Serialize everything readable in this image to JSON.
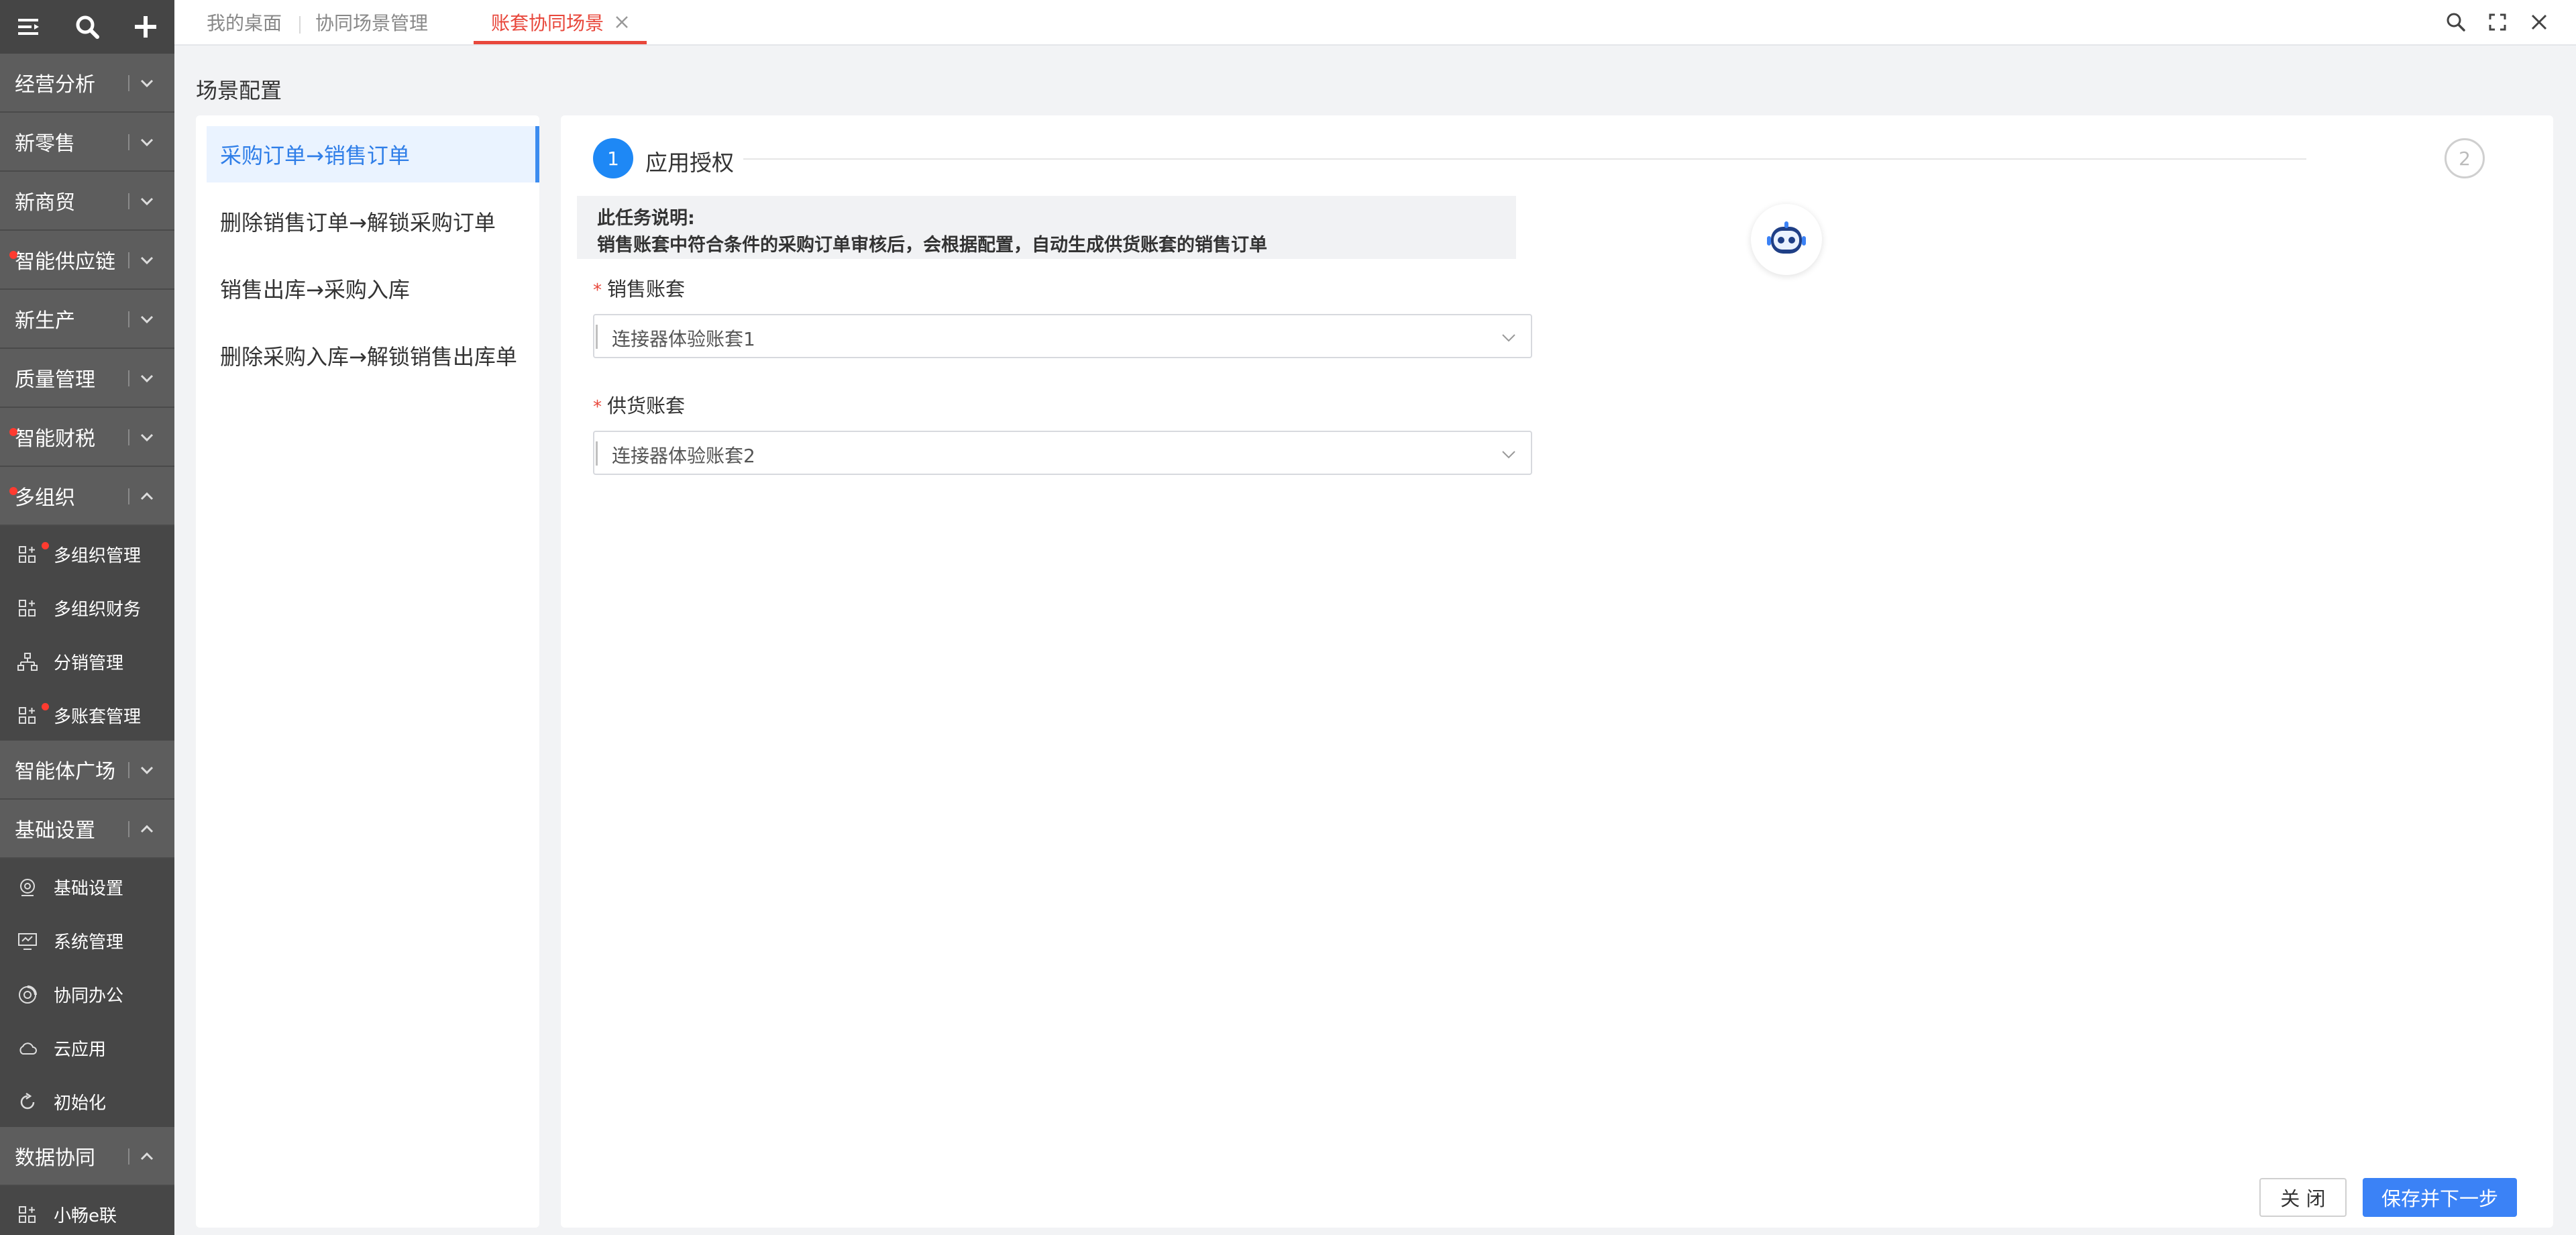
{
  "sidebar": {
    "toolbar": [
      {
        "icon": "menu-collapse-icon"
      },
      {
        "icon": "search-icon"
      },
      {
        "icon": "plus-icon"
      }
    ],
    "menu": [
      {
        "type": "cat",
        "label": "经营分析",
        "expanded": false,
        "dot": false
      },
      {
        "type": "cat",
        "label": "新零售",
        "expanded": false,
        "dot": false
      },
      {
        "type": "cat",
        "label": "新商贸",
        "expanded": false,
        "dot": false
      },
      {
        "type": "cat",
        "label": "智能供应链",
        "expanded": false,
        "dot": true
      },
      {
        "type": "cat",
        "label": "新生产",
        "expanded": false,
        "dot": false
      },
      {
        "type": "cat",
        "label": "质量管理",
        "expanded": false,
        "dot": false
      },
      {
        "type": "cat",
        "label": "智能财税",
        "expanded": false,
        "dot": true
      },
      {
        "type": "cat",
        "label": "多组织",
        "expanded": true,
        "dot": true
      },
      {
        "type": "sub",
        "label": "多组织管理",
        "icon": "grid-plus-icon",
        "dot": true
      },
      {
        "type": "sub",
        "label": "多组织财务",
        "icon": "grid-plus-icon",
        "dot": false
      },
      {
        "type": "sub",
        "label": "分销管理",
        "icon": "hierarchy-icon",
        "dot": false
      },
      {
        "type": "sub",
        "label": "多账套管理",
        "icon": "grid-plus-icon",
        "dot": true
      },
      {
        "type": "cat",
        "label": "智能体广场",
        "expanded": false,
        "dot": false
      },
      {
        "type": "cat",
        "label": "基础设置",
        "expanded": true,
        "dot": false
      },
      {
        "type": "sub",
        "label": "基础设置",
        "icon": "webcam-icon",
        "dot": false
      },
      {
        "type": "sub",
        "label": "系统管理",
        "icon": "monitor-icon",
        "dot": false
      },
      {
        "type": "sub",
        "label": "协同办公",
        "icon": "collab-icon",
        "dot": false
      },
      {
        "type": "sub",
        "label": "云应用",
        "icon": "cloud-icon",
        "dot": false
      },
      {
        "type": "sub",
        "label": "初始化",
        "icon": "refresh-icon",
        "dot": false
      },
      {
        "type": "cat",
        "label": "数据协同",
        "expanded": true,
        "dot": false
      },
      {
        "type": "sub",
        "label": "小畅e联",
        "icon": "grid-plus-icon",
        "dot": false
      }
    ]
  },
  "tabs": [
    {
      "label": "我的桌面",
      "active": false
    },
    {
      "label": "协同场景管理",
      "active": false
    },
    {
      "label": "账套协同场景",
      "active": true
    }
  ],
  "window_controls": [
    "search-icon",
    "fullscreen-icon",
    "close-icon"
  ],
  "page": {
    "title": "场景配置"
  },
  "scenes": [
    {
      "label": "采购订单→销售订单",
      "selected": true
    },
    {
      "label": "删除销售订单→解锁采购订单",
      "selected": false
    },
    {
      "label": "销售出库→采购入库",
      "selected": false
    },
    {
      "label": "删除采购入库→解锁销售出库单",
      "selected": false
    }
  ],
  "steps": [
    {
      "number": "1",
      "label": "应用授权",
      "active": true
    },
    {
      "number": "2",
      "label": "",
      "active": false
    }
  ],
  "description": {
    "title": "此任务说明:",
    "text": "销售账套中符合条件的采购订单审核后，会根据配置，自动生成供货账套的销售订单"
  },
  "form": {
    "required_mark": "*",
    "sales_account": {
      "label": "销售账套",
      "value": "连接器体验账套1"
    },
    "supply_account": {
      "label": "供货账套",
      "value": "连接器体验账套2"
    }
  },
  "buttons": {
    "close": "关 闭",
    "save_next": "保存并下一步"
  },
  "colors": {
    "sidebar_bg": "#505050",
    "accent_red": "#e8473b",
    "primary_blue": "#3b82f6",
    "step_blue": "#1e88f5",
    "selected_bg": "#eaf3ff"
  }
}
